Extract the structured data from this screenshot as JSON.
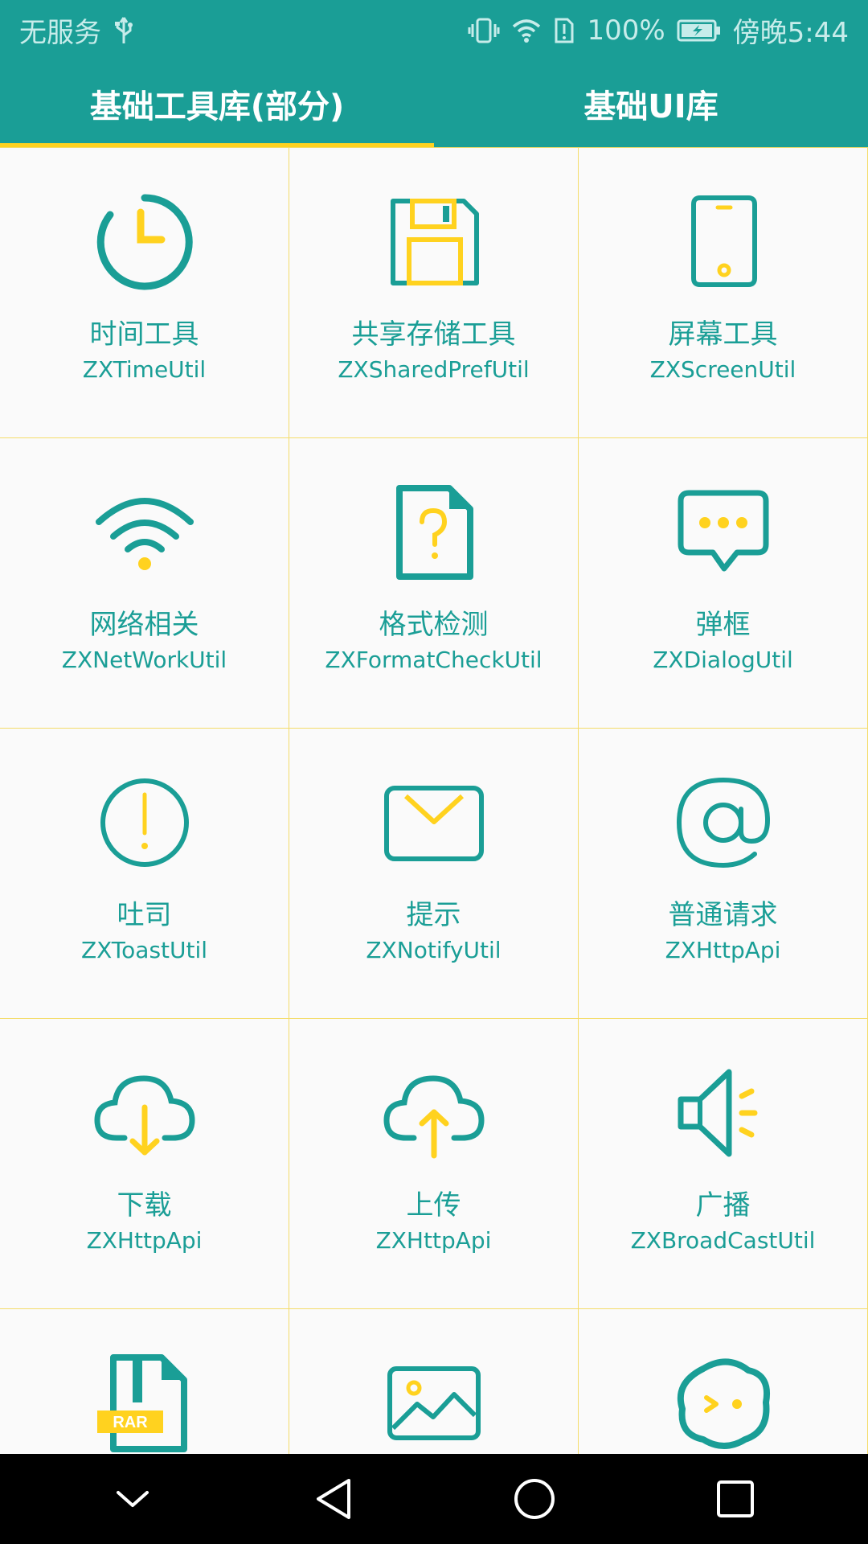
{
  "status": {
    "carrier": "无服务",
    "battery": "100%",
    "time": "傍晚5:44"
  },
  "tabs": [
    {
      "label": "基础工具库(部分)",
      "active": true
    },
    {
      "label": "基础UI库",
      "active": false
    }
  ],
  "colors": {
    "primary": "#1a9e96",
    "accent": "#ffd21f",
    "divider": "#f4dc6a"
  },
  "items": [
    {
      "cn": "时间工具",
      "en": "ZXTimeUtil",
      "icon": "clock-icon"
    },
    {
      "cn": "共享存储工具",
      "en": "ZXSharedPrefUtil",
      "icon": "floppy-disk-icon"
    },
    {
      "cn": "屏幕工具",
      "en": "ZXScreenUtil",
      "icon": "phone-icon"
    },
    {
      "cn": "网络相关",
      "en": "ZXNetWorkUtil",
      "icon": "wifi-icon"
    },
    {
      "cn": "格式检测",
      "en": "ZXFormatCheckUtil",
      "icon": "question-file-icon"
    },
    {
      "cn": "弹框",
      "en": "ZXDialogUtil",
      "icon": "chat-bubble-icon"
    },
    {
      "cn": "吐司",
      "en": "ZXToastUtil",
      "icon": "alert-circle-icon"
    },
    {
      "cn": "提示",
      "en": "ZXNotifyUtil",
      "icon": "mail-icon"
    },
    {
      "cn": "普通请求",
      "en": "ZXHttpApi",
      "icon": "at-icon"
    },
    {
      "cn": "下载",
      "en": "ZXHttpApi",
      "icon": "cloud-download-icon"
    },
    {
      "cn": "上传",
      "en": "ZXHttpApi",
      "icon": "cloud-upload-icon"
    },
    {
      "cn": "广播",
      "en": "ZXBroadCastUtil",
      "icon": "megaphone-icon"
    },
    {
      "cn": "",
      "en": "",
      "icon": "rar-file-icon"
    },
    {
      "cn": "",
      "en": "",
      "icon": "image-icon"
    },
    {
      "cn": "",
      "en": "",
      "icon": "terminal-blob-icon"
    }
  ]
}
